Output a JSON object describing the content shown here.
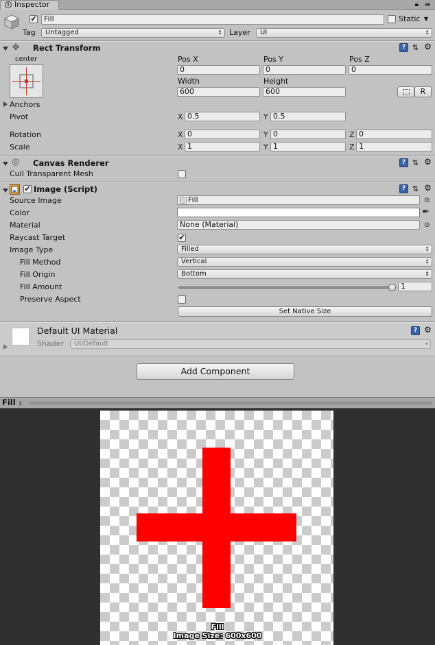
{
  "window": {
    "tab_label": "Inspector",
    "tab_icon": "info-icon"
  },
  "object": {
    "active": true,
    "name": "Fill",
    "static_label": "Static",
    "static_checked": false,
    "tag_label": "Tag",
    "tag_value": "Untagged",
    "layer_label": "Layer",
    "layer_value": "UI"
  },
  "rect_transform": {
    "title": "Rect Transform",
    "anchor_h": "center",
    "anchor_v": "middle",
    "pos_x_label": "Pos X",
    "pos_y_label": "Pos Y",
    "pos_z_label": "Pos Z",
    "pos_x": "0",
    "pos_y": "0",
    "pos_z": "0",
    "width_label": "Width",
    "height_label": "Height",
    "width": "600",
    "height": "600",
    "raw_button": "R",
    "anchors_label": "Anchors",
    "pivot_label": "Pivot",
    "pivot_x": "0.5",
    "pivot_y": "0.5",
    "rotation_label": "Rotation",
    "rotation_x": "0",
    "rotation_y": "0",
    "rotation_z": "0",
    "scale_label": "Scale",
    "scale_x": "1",
    "scale_y": "1",
    "scale_z": "1",
    "axis_x": "X",
    "axis_y": "Y",
    "axis_z": "Z"
  },
  "canvas_renderer": {
    "title": "Canvas Renderer",
    "cull_label": "Cull Transparent Mesh",
    "cull_checked": false
  },
  "image": {
    "title": "Image (Script)",
    "enabled": true,
    "source_label": "Source Image",
    "source_value": "Fill",
    "color_label": "Color",
    "color_value": "#ffffff",
    "material_label": "Material",
    "material_value": "None (Material)",
    "raycast_label": "Raycast Target",
    "raycast_checked": true,
    "type_label": "Image Type",
    "type_value": "Filled",
    "fill_method_label": "Fill Method",
    "fill_method_value": "Vertical",
    "fill_origin_label": "Fill Origin",
    "fill_origin_value": "Bottom",
    "fill_amount_label": "Fill Amount",
    "fill_amount_value": "1",
    "fill_amount": 1,
    "preserve_label": "Preserve Aspect",
    "preserve_checked": false,
    "native_size_button": "Set Native Size"
  },
  "material": {
    "name": "Default UI Material",
    "shader_label": "Shader",
    "shader_value": "UI/Default"
  },
  "add_component_button": "Add Component",
  "preview": {
    "title": "Fill",
    "name": "Fill",
    "size_text": "Image Size: 600x600",
    "fill_color": "#ff0000"
  }
}
